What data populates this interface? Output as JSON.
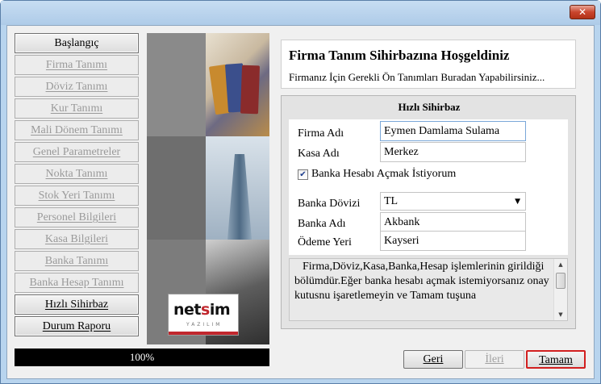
{
  "window": {
    "close_glyph": "✕"
  },
  "nav": {
    "items": [
      {
        "label": "Başlangıç",
        "state": "enabled"
      },
      {
        "label": "Firma Tanımı",
        "state": "disabled"
      },
      {
        "label": "Döviz Tanımı",
        "state": "disabled"
      },
      {
        "label": "Kur Tanımı",
        "state": "disabled"
      },
      {
        "label": "Mali Dönem Tanımı",
        "state": "disabled"
      },
      {
        "label": "Genel Parametreler",
        "state": "disabled"
      },
      {
        "label": "Nokta Tanımı",
        "state": "disabled"
      },
      {
        "label": "Stok Yeri Tanımı",
        "state": "disabled"
      },
      {
        "label": "Personel Bilgileri",
        "state": "disabled"
      },
      {
        "label": "Kasa Bilgileri",
        "state": "disabled"
      },
      {
        "label": "Banka Tanımı",
        "state": "disabled"
      },
      {
        "label": "Banka Hesap Tanımı",
        "state": "disabled"
      },
      {
        "label": "Hızlı Sihirbaz",
        "state": "enabled"
      },
      {
        "label": "Durum Raporu",
        "state": "enabled"
      }
    ]
  },
  "logo": {
    "wordmark_pre": "net",
    "wordmark_accent": "s",
    "wordmark_post": "im",
    "sub": "YAZILIM"
  },
  "welcome": {
    "title": "Firma Tanım Sihirbazına Hoşgeldiniz",
    "subtitle": "Firmanız İçin Gerekli Ön Tanımları Buradan Yapabilirsiniz..."
  },
  "wizard": {
    "title": "Hızlı Sihirbaz",
    "firma_adi_label": "Firma Adı",
    "firma_adi_value": "Eymen Damlama Sulama",
    "kasa_adi_label": "Kasa Adı",
    "kasa_adi_value": "Merkez",
    "bank_account_checkbox_label": "Banka Hesabı Açmak İstiyorum",
    "bank_account_checked": true,
    "check_glyph": "✔",
    "banka_dovizi_label": "Banka Dövizi",
    "banka_dovizi_value": "TL",
    "banka_adi_label": "Banka Adı",
    "banka_adi_value": "Akbank",
    "odeme_yeri_label": "Ödeme Yeri",
    "odeme_yeri_value": "Kayseri",
    "info_text": "Firma,Döviz,Kasa,Banka,Hesap işlemlerinin girildiği bölümdür.Eğer banka hesabı açmak istemiyorsanız onay kutusnu işaretlemeyin ve Tamam tuşuna"
  },
  "progress": {
    "label": "100%",
    "value": 1.0
  },
  "buttons": {
    "back": "Geri",
    "next": "İleri",
    "ok": "Tamam"
  },
  "colors": {
    "default_button_border": "#d21f1f",
    "close_button": "#c9452d",
    "progress_fill": "#000000"
  }
}
